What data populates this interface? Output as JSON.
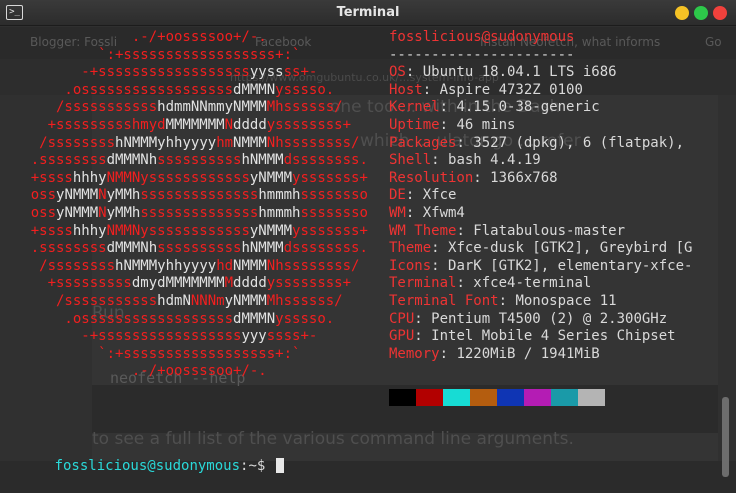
{
  "window": {
    "title": "Terminal",
    "app_icon_glyph": ">_"
  },
  "background": {
    "tabs": [
      "Blogger: Fossli",
      "Facebook",
      "Install Neofetch, what informs",
      "Go"
    ],
    "url": "https://www.omgubuntu.co.uk/...system-info-app",
    "lines": [
      "one too ... with in the Dash",
      "which ... ulator go ... refer",
      "Run",
      "neofetch --help",
      "to see a full list of the various command line arguments."
    ]
  },
  "logo_lines": [
    "                .-/+oossssoo+/-.",
    "            `:+ssssssssssssssssss+:`",
    "          -+ssssssssssssssssssyyssss+-",
    "        .ossssssssssssssssssdMMMNysssso.",
    "       /ssssssssssshdmmNNmmyNMMMMhssssss/",
    "      +ssssssssshmydMMMMMMMNddddyssssssss+",
    "     /sssssssshNMMMyhhyyyyhmNMMMNhssssssss/",
    "    .ssssssssdMMMNhsssssssssshNMMMdssssssss.",
    "    +sssshhhyNMMNyssssssssssssyNMMMysssssss+",
    "    ossyNMMMNyMMhsssssssssssssshmmmhssssssso",
    "    ossyNMMMNyMMhsssssssssssssshmmmhssssssso",
    "    +sssshhhyNMMNyssssssssssssyNMMMysssssss+",
    "    .ssssssssdMMMNhsssssssssshNMMMdssssssss.",
    "     /sssssssshNMMMyhhyyyyhdNMMMNhssssssss/",
    "      +sssssssssdmydMMMMMMMMddddyssssssss+",
    "       /ssssssssssshdmNNNNmyNMMMMhssssss/",
    "        .ossssssssssssssssssdMMMNysssso.",
    "          -+sssssssssssssssssyyyssss+-",
    "            `:+ssssssssssssssssss+:`",
    "                .-/+oossssoo+/-."
  ],
  "user_host": "fosslicious@sudonymous",
  "separator": "----------------------",
  "info": [
    {
      "key": "OS",
      "value": "Ubuntu 18.04.1 LTS i686"
    },
    {
      "key": "Host",
      "value": "Aspire 4732Z 0100"
    },
    {
      "key": "Kernel",
      "value": "4.15.0-38-generic"
    },
    {
      "key": "Uptime",
      "value": "46 mins"
    },
    {
      "key": "Packages",
      "value": "3527 (dpkg), 6 (flatpak),"
    },
    {
      "key": "Shell",
      "value": "bash 4.4.19"
    },
    {
      "key": "Resolution",
      "value": "1366x768"
    },
    {
      "key": "DE",
      "value": "Xfce"
    },
    {
      "key": "WM",
      "value": "Xfwm4"
    },
    {
      "key": "WM Theme",
      "value": "Flatabulous-master"
    },
    {
      "key": "Theme",
      "value": "Xfce-dusk [GTK2], Greybird [G"
    },
    {
      "key": "Icons",
      "value": "DarK [GTK2], elementary-xfce-"
    },
    {
      "key": "Terminal",
      "value": "xfce4-terminal"
    },
    {
      "key": "Terminal Font",
      "value": "Monospace 11"
    },
    {
      "key": "CPU",
      "value": "Pentium T4500 (2) @ 2.300GHz"
    },
    {
      "key": "GPU",
      "value": "Intel Mobile 4 Series Chipset"
    },
    {
      "key": "Memory",
      "value": "1220MiB / 1941MiB"
    }
  ],
  "palette": [
    "#000000",
    "#b20000",
    "#17dcd4",
    "#b45d0f",
    "#0f35b4",
    "#b41cb4",
    "#1a9aa8",
    "#b4b4b4"
  ],
  "prompt": {
    "user_host": "fosslicious@sudonymous",
    "path_and_symbol": ":~$"
  },
  "colors": {
    "logo": "#f21f1f",
    "key": "#ee3333",
    "prompt_user": "#2ad9d9"
  }
}
